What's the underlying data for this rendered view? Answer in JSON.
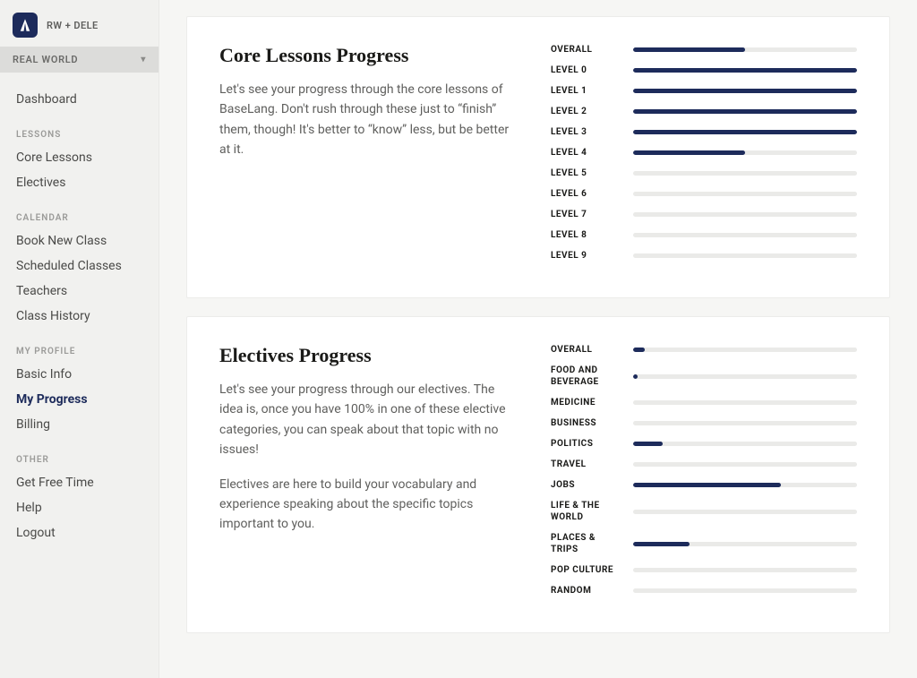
{
  "brand": {
    "label": "RW + DELE"
  },
  "program_selector": {
    "label": "REAL WORLD"
  },
  "sidebar": {
    "groups": [
      {
        "heading": null,
        "items": [
          {
            "label": "Dashboard",
            "active": false
          }
        ]
      },
      {
        "heading": "LESSONS",
        "items": [
          {
            "label": "Core Lessons",
            "active": false
          },
          {
            "label": "Electives",
            "active": false
          }
        ]
      },
      {
        "heading": "CALENDAR",
        "items": [
          {
            "label": "Book New Class",
            "active": false
          },
          {
            "label": "Scheduled Classes",
            "active": false
          },
          {
            "label": "Teachers",
            "active": false
          },
          {
            "label": "Class History",
            "active": false
          }
        ]
      },
      {
        "heading": "MY PROFILE",
        "items": [
          {
            "label": "Basic Info",
            "active": false
          },
          {
            "label": "My Progress",
            "active": true
          },
          {
            "label": "Billing",
            "active": false
          }
        ]
      },
      {
        "heading": "OTHER",
        "items": [
          {
            "label": "Get Free Time",
            "active": false
          },
          {
            "label": "Help",
            "active": false
          },
          {
            "label": "Logout",
            "active": false
          }
        ]
      }
    ]
  },
  "cards": [
    {
      "title": "Core Lessons Progress",
      "descriptions": [
        "Let's see your progress through the core lessons of BaseLang. Don't rush through these just to “finish” them, though! It's better to “know” less, but be better at it."
      ],
      "metrics": [
        {
          "label": "OVERALL",
          "pct": 50
        },
        {
          "label": "LEVEL 0",
          "pct": 100
        },
        {
          "label": "LEVEL 1",
          "pct": 100
        },
        {
          "label": "LEVEL 2",
          "pct": 100
        },
        {
          "label": "LEVEL 3",
          "pct": 100
        },
        {
          "label": "LEVEL 4",
          "pct": 50
        },
        {
          "label": "LEVEL 5",
          "pct": 0
        },
        {
          "label": "LEVEL 6",
          "pct": 0
        },
        {
          "label": "LEVEL 7",
          "pct": 0
        },
        {
          "label": "LEVEL 8",
          "pct": 0
        },
        {
          "label": "LEVEL 9",
          "pct": 0
        }
      ]
    },
    {
      "title": "Electives Progress",
      "descriptions": [
        "Let's see your progress through our electives. The idea is, once you have 100% in one of these elective categories, you can speak about that topic with no issues!",
        "Electives are here to build your vocabulary and experience speaking about the specific topics important to you."
      ],
      "metrics": [
        {
          "label": "OVERALL",
          "pct": 5
        },
        {
          "label": "FOOD AND BEVERAGE",
          "pct": 2
        },
        {
          "label": "MEDICINE",
          "pct": 0
        },
        {
          "label": "BUSINESS",
          "pct": 0
        },
        {
          "label": "POLITICS",
          "pct": 13
        },
        {
          "label": "TRAVEL",
          "pct": 0
        },
        {
          "label": "JOBS",
          "pct": 66
        },
        {
          "label": "LIFE & THE WORLD",
          "pct": 0
        },
        {
          "label": "PLACES & TRIPS",
          "pct": 25
        },
        {
          "label": "POP CULTURE",
          "pct": 0
        },
        {
          "label": "RANDOM",
          "pct": 0
        }
      ]
    }
  ]
}
